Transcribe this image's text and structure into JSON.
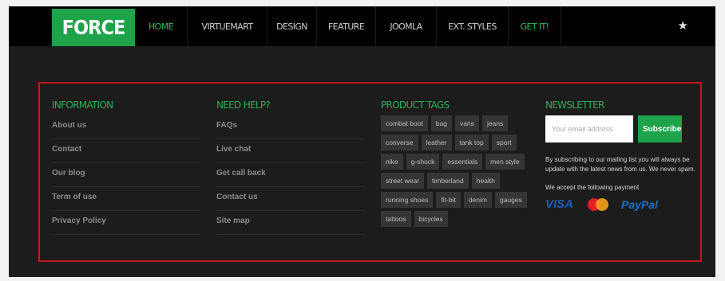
{
  "header": {
    "logo": "FORCE",
    "nav": [
      {
        "label": "HOME",
        "active": true
      },
      {
        "label": "VIRTUEMART"
      },
      {
        "label": "DESIGN"
      },
      {
        "label": "FEATURE"
      },
      {
        "label": "JOOMLA"
      },
      {
        "label": "EXT. STYLES"
      },
      {
        "label": "GET IT!",
        "highlight": true
      }
    ],
    "star_icon": "★"
  },
  "footer": {
    "information": {
      "title": "INFORMATION",
      "links": [
        "About us",
        "Contact",
        "Our blog",
        "Term of use",
        "Privacy Policy"
      ]
    },
    "help": {
      "title": "NEED HELP?",
      "links": [
        "FAQs",
        "Live chat",
        "Get call back",
        "Contact us",
        "Site map"
      ]
    },
    "tags": {
      "title": "PRODUCT TAGS",
      "items": [
        "combat boot",
        "bag",
        "vans",
        "jeans",
        "converse",
        "leather",
        "tank top",
        "sport",
        "nike",
        "g-shock",
        "essentials",
        "men style",
        "street wear",
        "timberland",
        "health",
        "running shoes",
        "fit-bit",
        "denim",
        "gauges",
        "tattoos",
        "bicycles"
      ]
    },
    "newsletter": {
      "title": "NEWSLETTER",
      "placeholder": "Your email address",
      "button": "Subscribe",
      "text": "By subscribing to our mailing list you will always be update with the latest news from us. We never spam.",
      "payment_label": "We accept the following payment",
      "visa": "VISA",
      "paypal": "PayPal"
    }
  },
  "colors": {
    "accent": "#1ea24a",
    "border": "#c0171c"
  }
}
